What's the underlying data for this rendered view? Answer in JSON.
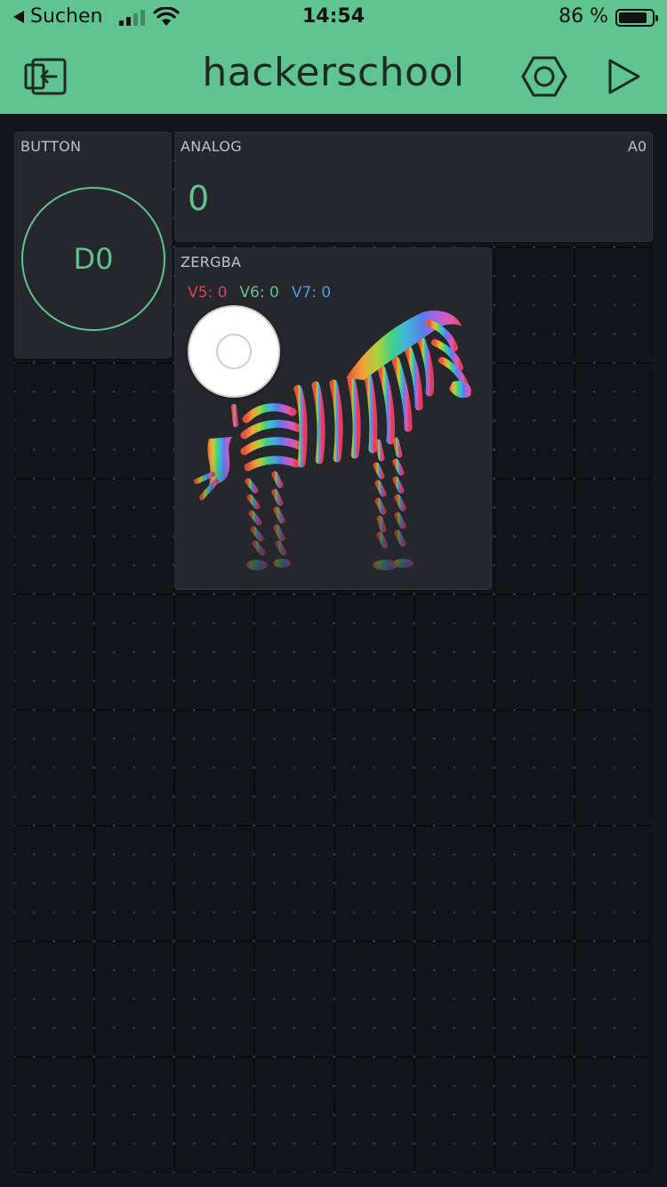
{
  "status_bar": {
    "back_label": "Suchen",
    "time": "14:54",
    "battery_percent": "86 %",
    "battery_level": 0.86
  },
  "nav": {
    "title": "hackerschool",
    "icons": [
      "exit-icon",
      "settings-hexagon-icon",
      "play-icon"
    ]
  },
  "widgets": {
    "button": {
      "label": "BUTTON",
      "pin": "D0"
    },
    "analog": {
      "label": "ANALOG",
      "pin": "A0",
      "value": "0"
    },
    "zergba": {
      "label": "ZERGBA",
      "v5": "V5: 0",
      "v6": "V6: 0",
      "v7": "V7: 0"
    }
  },
  "colors": {
    "accent": "#5fc48f",
    "background": "#15161b",
    "widget": "#25272d",
    "red_pin": "#d3455b",
    "blue_pin": "#4a9ee0"
  }
}
